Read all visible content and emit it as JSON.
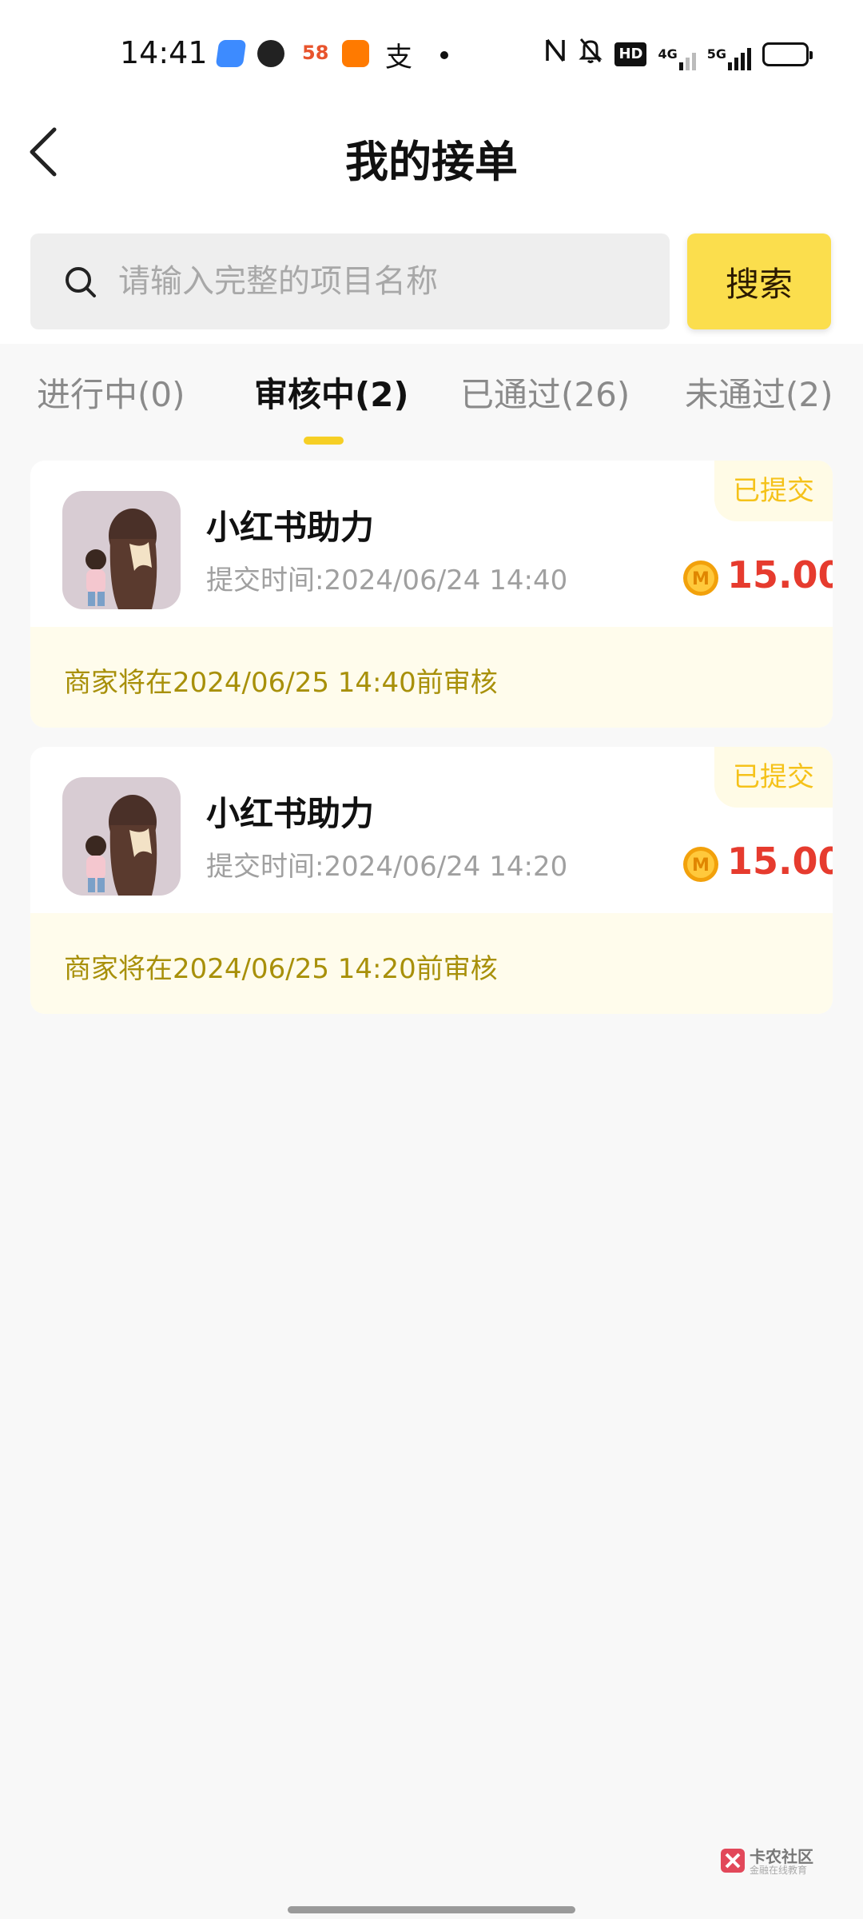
{
  "status_bar": {
    "time": "14:41",
    "net_4g": "4G",
    "net_5g": "5G",
    "hd_label": "HD",
    "app_58": "58",
    "app_alipay": "支"
  },
  "header": {
    "title": "我的接单"
  },
  "search": {
    "placeholder": "请输入完整的项目名称",
    "button_label": "搜索"
  },
  "tabs": [
    {
      "label": "进行中(0)",
      "active": false
    },
    {
      "label": "审核中(2)",
      "active": true
    },
    {
      "label": "已通过(26)",
      "active": false
    },
    {
      "label": "未通过(2)",
      "active": false
    }
  ],
  "orders": [
    {
      "status": "已提交",
      "title": "小红书助力",
      "submit_time": "提交时间:2024/06/24 14:40",
      "coin_label": "M",
      "price": "15.00",
      "review_note": "商家将在2024/06/25 14:40前审核"
    },
    {
      "status": "已提交",
      "title": "小红书助力",
      "submit_time": "提交时间:2024/06/24 14:20",
      "coin_label": "M",
      "price": "15.00",
      "review_note": "商家将在2024/06/25 14:20前审核"
    }
  ],
  "watermark": {
    "name": "卡农社区",
    "subtitle": "金融在线教育"
  },
  "colors": {
    "accent_yellow": "#fbde4d",
    "price_red": "#e63b2e",
    "status_text": "#f5c21a",
    "note_text": "#a8900a"
  }
}
